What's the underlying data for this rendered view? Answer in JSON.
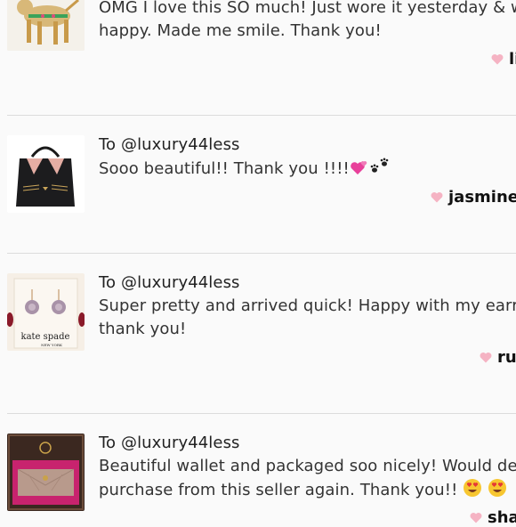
{
  "reviews": [
    {
      "to": "",
      "lines": [
        "OMG I love this SO much! Just wore it yesterday & w",
        "happy. Made me smile. Thank you!"
      ],
      "author": "li"
    },
    {
      "to": "To @luxury44less",
      "lines": [
        "Sooo beautiful!! Thank you !!!!"
      ],
      "author": "jasminer"
    },
    {
      "to": "To @luxury44less",
      "lines": [
        "Super pretty and arrived quick! Happy with my earrin",
        "thank you!"
      ],
      "author": "rul"
    },
    {
      "to": "To @luxury44less",
      "lines": [
        "Beautiful wallet and packaged soo nicely! Would def",
        "purchase from this seller again. Thank you!! "
      ],
      "author": "sha"
    }
  ],
  "thumb_text": {
    "kate_spade_card": "kate spade",
    "kate_spade_sub": "NEW YORK"
  },
  "colors": {
    "heart": "#f5b3c3",
    "divider": "#dcdcdc",
    "emoji_heart": "#e8409a"
  }
}
